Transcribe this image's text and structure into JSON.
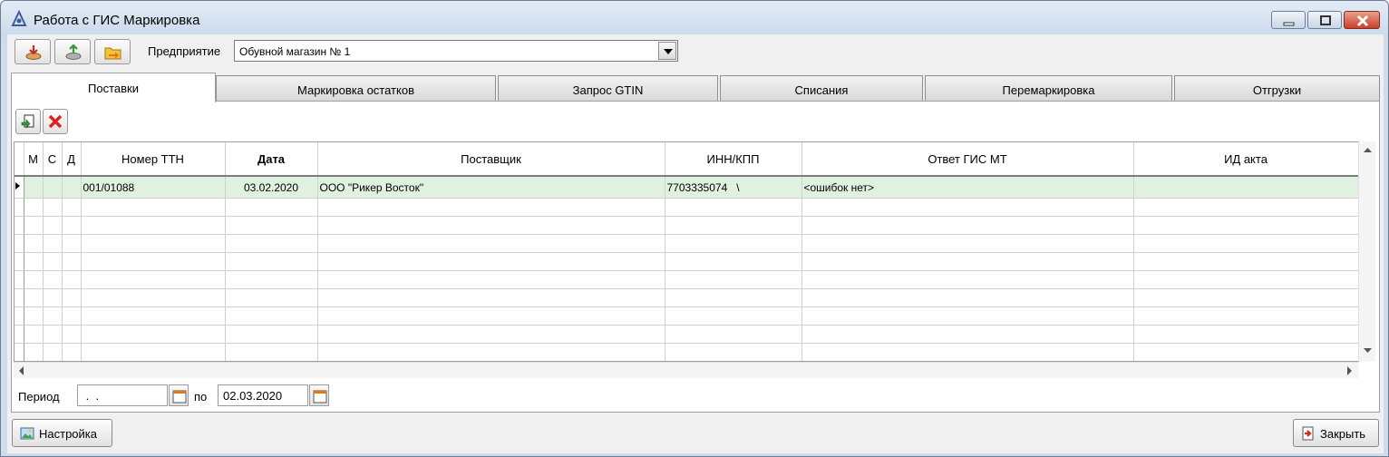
{
  "window": {
    "title": "Работа с ГИС Маркировка"
  },
  "toolbar": {
    "enterprise_label": "Предприятие",
    "enterprise_value": "Обувной магазин № 1",
    "buttons": [
      "import-icon",
      "export-icon",
      "open-folder-icon"
    ]
  },
  "tabs": [
    {
      "label": "Поставки",
      "active": true
    },
    {
      "label": "Маркировка остатков",
      "active": false
    },
    {
      "label": "Запрос GTIN",
      "active": false
    },
    {
      "label": "Списания",
      "active": false
    },
    {
      "label": "Перемаркировка",
      "active": false
    },
    {
      "label": "Отгрузки",
      "active": false
    }
  ],
  "grid": {
    "columns": [
      "М",
      "С",
      "Д",
      "Номер ТТН",
      "Дата",
      "Поставщик",
      "ИНН/КПП",
      "Ответ ГИС МТ",
      "ИД акта"
    ],
    "rows": [
      {
        "m": "",
        "c": "",
        "d": "",
        "ttn": "001/01088",
        "date": "03.02.2020",
        "supplier": "ООО \"Рикер Восток\"",
        "inn_kpp": "7703335074   \\",
        "response": "<ошибок нет>",
        "act_id": ""
      }
    ]
  },
  "period": {
    "label": "Период",
    "from": " .  .",
    "to_label": "по",
    "to": "02.03.2020"
  },
  "footer": {
    "settings_label": "Настройка",
    "close_label": "Закрыть"
  },
  "colors": {
    "selected_row": "#dff2df",
    "accent_close": "#c8402a"
  }
}
